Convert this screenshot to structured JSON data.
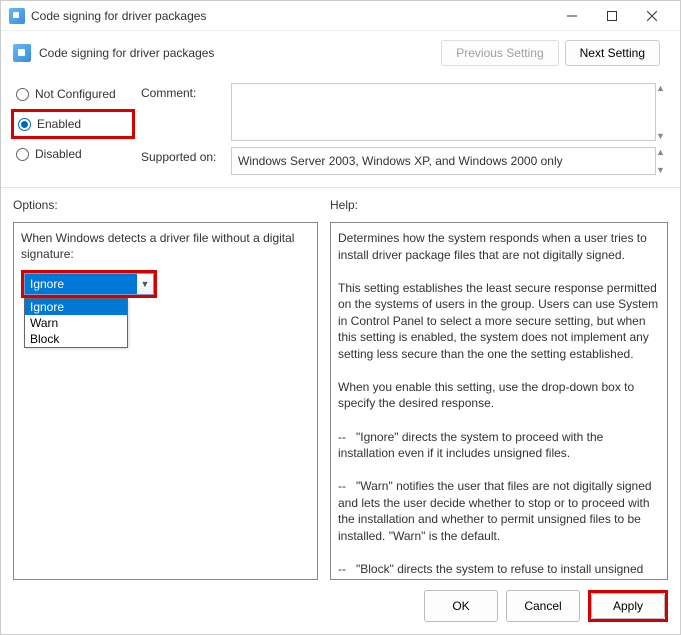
{
  "window": {
    "title": "Code signing for driver packages"
  },
  "header": {
    "title": "Code signing for driver packages"
  },
  "nav": {
    "prev_label": "Previous Setting",
    "next_label": "Next Setting"
  },
  "state_radios": {
    "not_configured": "Not Configured",
    "enabled": "Enabled",
    "disabled": "Disabled",
    "selected": "enabled"
  },
  "meta": {
    "comment_label": "Comment:",
    "comment_value": "",
    "supported_label": "Supported on:",
    "supported_value": "Windows Server 2003, Windows XP, and Windows 2000 only"
  },
  "options": {
    "title": "Options:",
    "label": "When Windows detects a driver file without a digital signature:",
    "selected": "Ignore",
    "items": [
      "Ignore",
      "Warn",
      "Block"
    ]
  },
  "help": {
    "title": "Help:",
    "text": "Determines how the system responds when a user tries to install driver package files that are not digitally signed.\n\nThis setting establishes the least secure response permitted on the systems of users in the group. Users can use System in Control Panel to select a more secure setting, but when this setting is enabled, the system does not implement any setting less secure than the one the setting established.\n\nWhen you enable this setting, use the drop-down box to specify the desired response.\n\n--   \"Ignore\" directs the system to proceed with the installation even if it includes unsigned files.\n\n--   \"Warn\" notifies the user that files are not digitally signed and lets the user decide whether to stop or to proceed with the installation and whether to permit unsigned files to be installed. \"Warn\" is the default.\n\n--   \"Block\" directs the system to refuse to install unsigned files."
  },
  "footer": {
    "ok": "OK",
    "cancel": "Cancel",
    "apply": "Apply"
  }
}
